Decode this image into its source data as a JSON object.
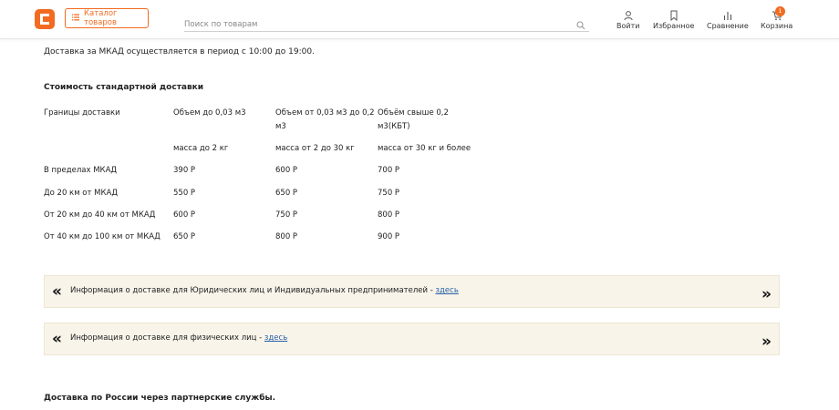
{
  "header": {
    "catalog_label": "Каталог товаров",
    "search_placeholder": "Поиск по товарам",
    "nav": {
      "login": "Войти",
      "favorites": "Избранное",
      "compare": "Сравнение",
      "cart": "Корзина",
      "cart_count": "1"
    },
    "accent_color": "#f26b21"
  },
  "content": {
    "delivery_time_note": "Доставка за МКАД осуществляется в период с 10:00 до 19:00.",
    "table_title": "Стоимость стандартной доставки",
    "table": {
      "col0_header": "Границы доставки",
      "col1_header": "Объем до 0,03 м3",
      "col2_header_l1": "Объем от 0,03 м3 до 0,2",
      "col2_header_l2": "м3",
      "col3_header_l1": "Объём свыше 0,2",
      "col3_header_l2": "м3(КБТ)",
      "col1_sub": "масса до 2 кг",
      "col2_sub": "масса от 2 до 30 кг",
      "col3_sub": "масса от 30 кг и более",
      "rows": [
        {
          "zone": "В пределах  МКАД",
          "c1": "390 Р",
          "c2": "600 Р",
          "c3": "700 Р"
        },
        {
          "zone": "До 20  км от МКАД",
          "c1": "550 Р",
          "c2": "650 Р",
          "c3": "750 Р"
        },
        {
          "zone": "От 20 км до 40 км от МКАД",
          "c1": "600 Р",
          "c2": "750 Р",
          "c3": "800 Р"
        },
        {
          "zone": "От 40 км до 100 км от МКАД",
          "c1": "650 Р",
          "c2": "800 Р",
          "c3": "900 Р"
        }
      ]
    },
    "info_legal": {
      "text": "Информация о доставке для Юридических лиц и Индивидуальных предпринимателей - ",
      "link": "здесь"
    },
    "info_individual": {
      "text": "Информация о доставке для физических лиц - ",
      "link": "здесь"
    },
    "russia_delivery_title": "Доставка по России через партнерские службы."
  }
}
